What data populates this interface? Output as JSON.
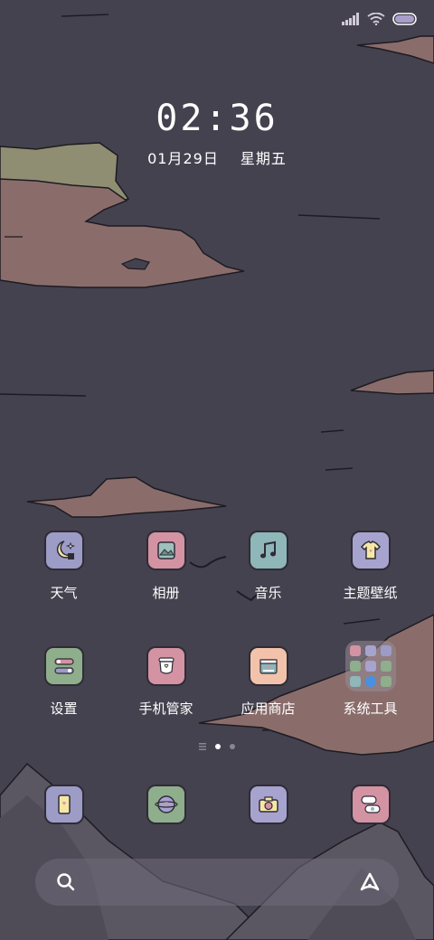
{
  "status_bar": {
    "signal_icon": "signal-icon",
    "wifi_icon": "wifi-icon",
    "battery_icon": "battery-icon",
    "battery_color": "#a99ec9"
  },
  "lockclock": {
    "time": "02:36",
    "date": "01月29日",
    "weekday": "星期五"
  },
  "apps": [
    {
      "label": "天气",
      "icon": "moon-weather-icon",
      "color": "#9c9cc6"
    },
    {
      "label": "相册",
      "icon": "photo-icon",
      "color": "#d393a3"
    },
    {
      "label": "音乐",
      "icon": "music-note-icon",
      "color": "#8fb6b8"
    },
    {
      "label": "主题壁纸",
      "icon": "tshirt-icon",
      "color": "#a7a3cf"
    },
    {
      "label": "设置",
      "icon": "toggle-icon",
      "color": "#8fae8c"
    },
    {
      "label": "手机管家",
      "icon": "shield-cup-icon",
      "color": "#d393a3"
    },
    {
      "label": "应用商店",
      "icon": "store-icon",
      "color": "#f2c3aa"
    },
    {
      "label": "系统工具",
      "icon": "folder-icon",
      "color": "#9a8f9a"
    }
  ],
  "dock": [
    {
      "name": "phone",
      "icon": "phone-icon",
      "color": "#9c9cc6"
    },
    {
      "name": "browser",
      "icon": "globe-icon",
      "color": "#8fae8c"
    },
    {
      "name": "camera",
      "icon": "camera-icon",
      "color": "#a7a3cf"
    },
    {
      "name": "messages",
      "icon": "chat-icon",
      "color": "#d393a3"
    }
  ],
  "search_bar": {
    "search_icon": "search-icon",
    "assistant_icon": "assistant-icon"
  },
  "page_indicator": {
    "current": 2,
    "total": 2
  }
}
